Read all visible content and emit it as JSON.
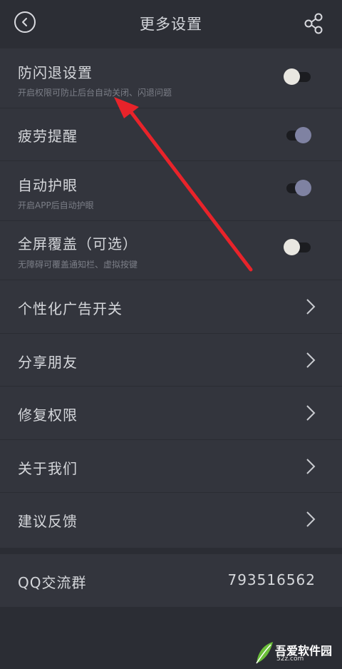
{
  "header": {
    "title": "更多设置",
    "back_icon": "back-circle-icon",
    "share_icon": "share-icon"
  },
  "settings": [
    {
      "label": "防闪退设置",
      "sub": "开启权限可防止后台自动关闭、闪退问题",
      "toggle": "off"
    },
    {
      "label": "疲劳提醒",
      "sub": "",
      "toggle": "on"
    },
    {
      "label": "自动护眼",
      "sub": "开启APP后自动护眼",
      "toggle": "on"
    },
    {
      "label": "全屏覆盖（可选）",
      "sub": "无障碍可覆盖通知栏、虚拟按键",
      "toggle": "off"
    }
  ],
  "menu": [
    {
      "label": "个性化广告开关"
    },
    {
      "label": "分享朋友"
    },
    {
      "label": "修复权限"
    },
    {
      "label": "关于我们"
    },
    {
      "label": "建议反馈"
    }
  ],
  "qq": {
    "label": "QQ交流群",
    "value": "793516562"
  },
  "colors": {
    "background": "#2b2d34",
    "row_background": "#33353d",
    "toggle_on": "#7f82a2",
    "toggle_off": "#e9e7e1",
    "annotation_arrow": "#e8232a"
  },
  "watermark": {
    "text": "吾爱软件园",
    "url": "52z.com"
  }
}
